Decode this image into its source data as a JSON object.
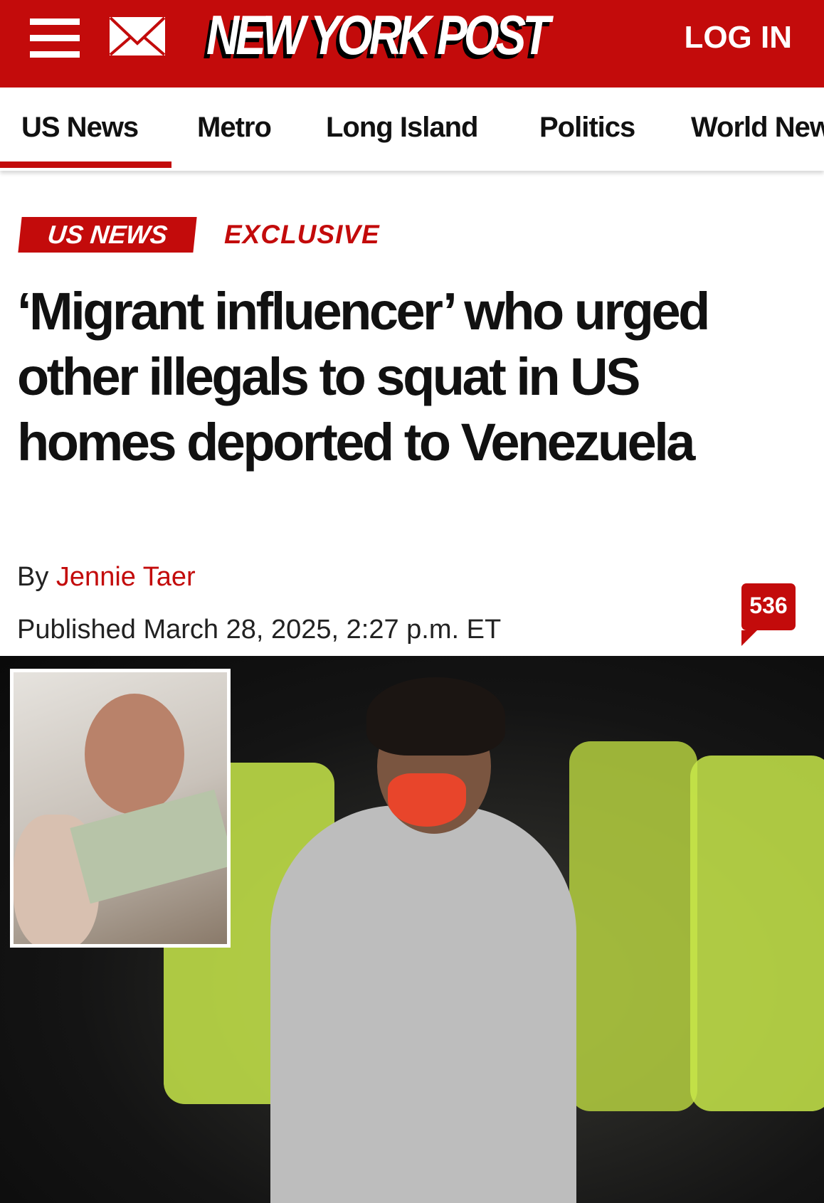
{
  "header": {
    "brand": "NEW YORK POST",
    "login_label": "LOG IN",
    "brand_color": "#c30b0b"
  },
  "nav": {
    "items": [
      {
        "label": "US News",
        "active": true
      },
      {
        "label": "Metro"
      },
      {
        "label": "Long Island"
      },
      {
        "label": "Politics"
      },
      {
        "label": "World News"
      }
    ]
  },
  "article": {
    "section_tag": "US NEWS",
    "label": "EXCLUSIVE",
    "headline": "‘Migrant influencer’ who urged other illegals to squat in US homes deported to Venezuela",
    "byline_prefix": "By",
    "author": "Jennie Taer",
    "published": "Published March 28, 2025, 2:27 p.m. ET",
    "comment_count": "536"
  }
}
